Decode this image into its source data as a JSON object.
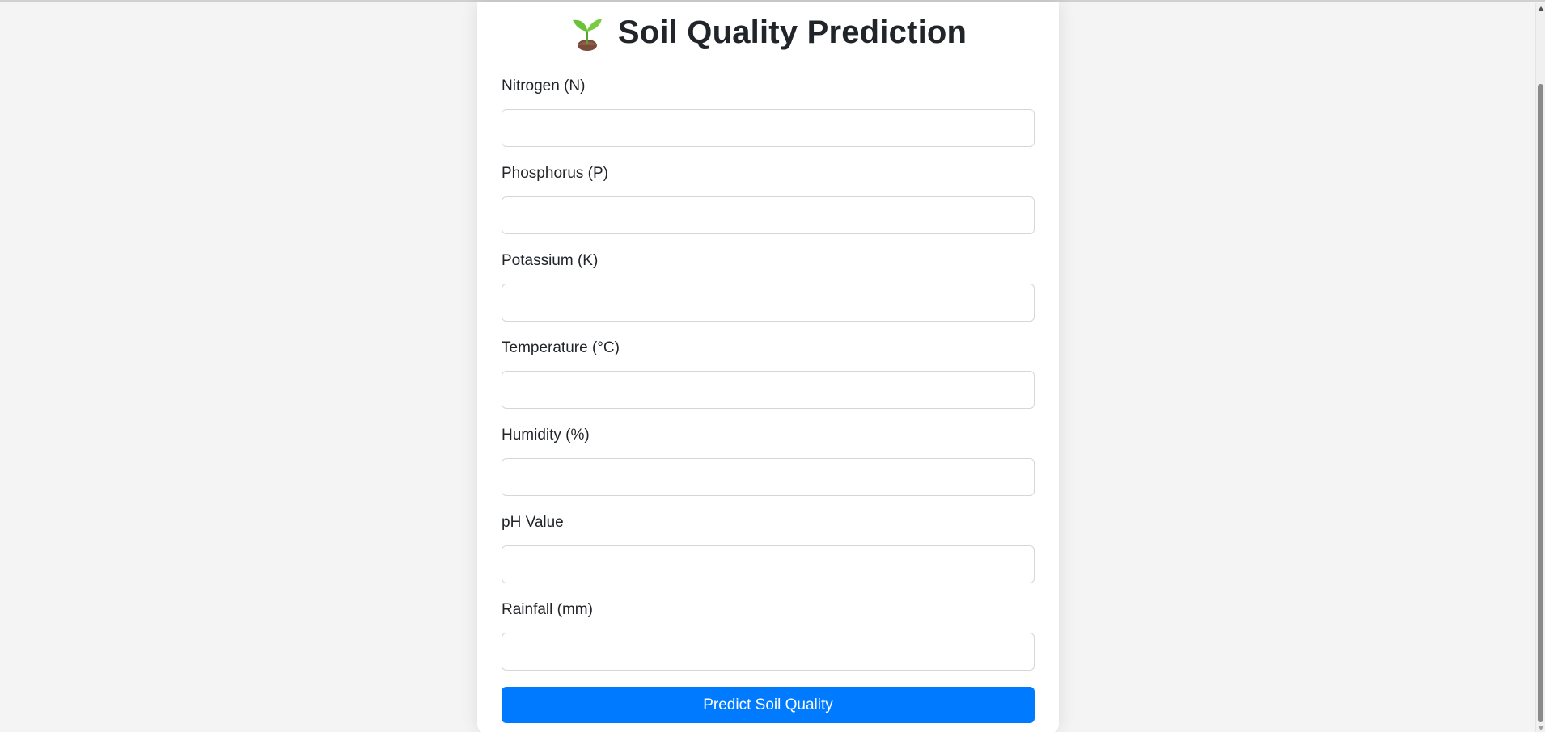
{
  "form": {
    "icon": "seedling-icon",
    "title": "Soil Quality Prediction",
    "fields": [
      {
        "label": "Nitrogen (N)",
        "value": "",
        "placeholder": ""
      },
      {
        "label": "Phosphorus (P)",
        "value": "",
        "placeholder": ""
      },
      {
        "label": "Potassium (K)",
        "value": "",
        "placeholder": ""
      },
      {
        "label": "Temperature (°C)",
        "value": "",
        "placeholder": ""
      },
      {
        "label": "Humidity (%)",
        "value": "",
        "placeholder": ""
      },
      {
        "label": "pH Value",
        "value": "",
        "placeholder": ""
      },
      {
        "label": "Rainfall (mm)",
        "value": "",
        "placeholder": ""
      }
    ],
    "submit_label": "Predict Soil Quality"
  },
  "colors": {
    "page_background": "#f4f4f4",
    "card_background": "#ffffff",
    "primary": "#007bff",
    "text": "#212529",
    "input_border": "#d6d6d6"
  }
}
